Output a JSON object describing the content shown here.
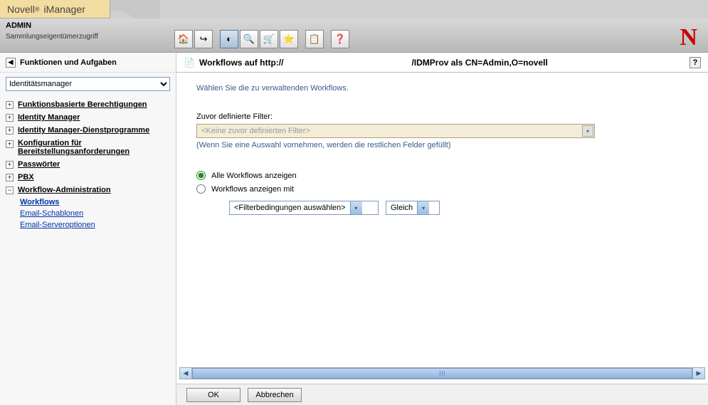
{
  "brand": {
    "company": "Novell",
    "product": "iManager"
  },
  "subheader": {
    "admin": "ADMIN",
    "access": "Sammlungseigentümerzugriff"
  },
  "sidebar": {
    "header": "Funktionen und Aufgaben",
    "role_selected": "Identitätsmanager",
    "items": [
      {
        "label": "Funktionsbasierte Berechtigungen",
        "expanded": false
      },
      {
        "label": "Identity Manager",
        "expanded": false
      },
      {
        "label": "Identity Manager-Dienstprogramme",
        "expanded": false
      },
      {
        "label": "Konfiguration für Bereitstellungsanforderungen",
        "expanded": false
      },
      {
        "label": "Passwörter",
        "expanded": false
      },
      {
        "label": "PBX",
        "expanded": false
      },
      {
        "label": "Workflow-Administration",
        "expanded": true,
        "children": [
          {
            "label": "Workflows",
            "active": true
          },
          {
            "label": "Email-Schablonen",
            "active": false
          },
          {
            "label": "Email-Serveroptionen",
            "active": false
          }
        ]
      }
    ]
  },
  "content": {
    "title_prefix": "Workflows auf http://",
    "title_suffix": "/IDMProv als CN=Admin,O=novell",
    "instruction": "Wählen Sie die zu verwaltenden Workflows.",
    "filter_label": "Zuvor definierte Filter:",
    "filter_placeholder": "<Keine zuvor definierten Filter>",
    "filter_hint": "(Wenn Sie eine Auswahl vornehmen, werden die restlichen Felder gefüllt)",
    "radio_all": "Alle Workflows anzeigen",
    "radio_with": "Workflows anzeigen mit",
    "condition_select": "<Filterbedingungen auswählen>",
    "operator_select": "Gleich",
    "help": "?"
  },
  "buttons": {
    "ok": "OK",
    "cancel": "Abbrechen"
  },
  "toolbar_icons": [
    "🏠",
    "↪",
    "◐",
    "🔍",
    "🛒",
    "⭐",
    "📋",
    "❓"
  ]
}
